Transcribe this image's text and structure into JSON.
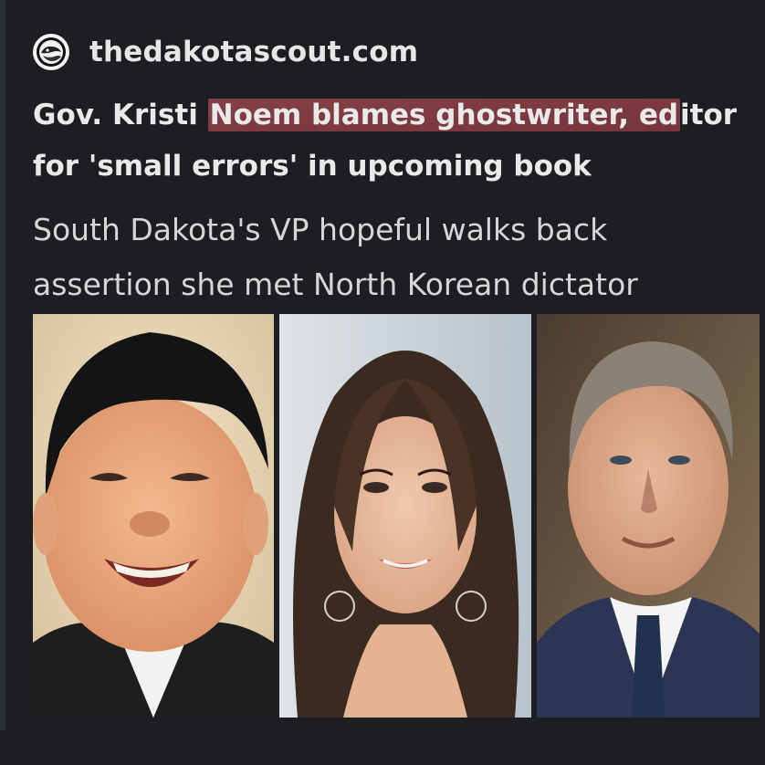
{
  "source": {
    "site_name": "thedakotascout.com",
    "favicon": "dakota-scout-logo-icon"
  },
  "headline": {
    "part1": "Gov. Kristi ",
    "highlighted": "Noem blames ghostwriter, ed",
    "part2": "itor for 'small errors' in upcoming book",
    "highlight_color": "#8c3c42"
  },
  "subhead": "South Dakota's VP hopeful walks back assertion she met North Korean dictator",
  "photos": [
    {
      "name": "portrait-photo-1"
    },
    {
      "name": "portrait-photo-2"
    },
    {
      "name": "portrait-photo-3"
    }
  ],
  "colors": {
    "background": "#1c1e22",
    "text": "#e9e9e9"
  }
}
